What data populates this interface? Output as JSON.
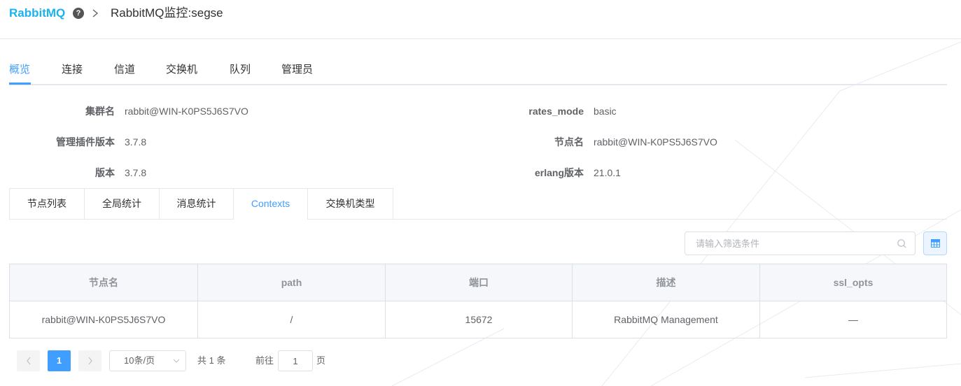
{
  "header": {
    "brand": "RabbitMQ",
    "help_icon_glyph": "?",
    "separator": ">",
    "title": "RabbitMQ监控:segse"
  },
  "main_tabs": [
    {
      "label": "概览",
      "active": true
    },
    {
      "label": "连接",
      "active": false
    },
    {
      "label": "信道",
      "active": false
    },
    {
      "label": "交换机",
      "active": false
    },
    {
      "label": "队列",
      "active": false
    },
    {
      "label": "管理员",
      "active": false
    }
  ],
  "info": {
    "left": [
      {
        "label": "集群名",
        "value": "rabbit@WIN-K0PS5J6S7VO"
      },
      {
        "label": "管理插件版本",
        "value": "3.7.8"
      },
      {
        "label": "版本",
        "value": "3.7.8"
      }
    ],
    "right": [
      {
        "label": "rates_mode",
        "value": "basic"
      },
      {
        "label": "节点名",
        "value": "rabbit@WIN-K0PS5J6S7VO"
      },
      {
        "label": "erlang版本",
        "value": "21.0.1"
      }
    ]
  },
  "sub_tabs": [
    {
      "label": "节点列表",
      "active": false
    },
    {
      "label": "全局统计",
      "active": false
    },
    {
      "label": "消息统计",
      "active": false
    },
    {
      "label": "Contexts",
      "active": true
    },
    {
      "label": "交换机类型",
      "active": false
    }
  ],
  "search": {
    "placeholder": "请输入筛选条件",
    "value": ""
  },
  "table": {
    "columns": [
      "节点名",
      "path",
      "端口",
      "描述",
      "ssl_opts"
    ],
    "rows": [
      [
        "rabbit@WIN-K0PS5J6S7VO",
        "/",
        "15672",
        "RabbitMQ Management",
        "—"
      ]
    ]
  },
  "pagination": {
    "prev": "<",
    "current_page": "1",
    "next": ">",
    "page_size": "10条/页",
    "total": "共 1 条",
    "goto_prefix": "前往",
    "goto_value": "1",
    "goto_suffix": "页"
  },
  "colors": {
    "brand": "#1ab3ee",
    "accent": "#409eff",
    "border": "#dcdfe6"
  },
  "icons": {
    "help": "question-circle-icon",
    "search": "search-icon",
    "table_toggle": "table-grid-icon",
    "page_size_arrow": "chevron-down-icon"
  }
}
